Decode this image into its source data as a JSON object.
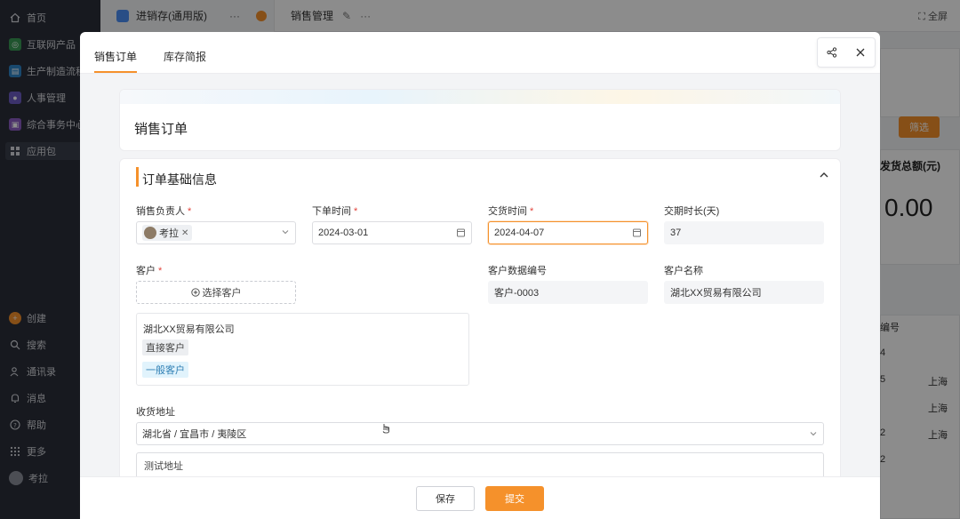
{
  "sidebar": {
    "items": [
      {
        "label": "首页",
        "icon": "home-icon"
      },
      {
        "label": "互联网产品",
        "icon": "app-icon"
      },
      {
        "label": "生产制造流程",
        "icon": "app-icon"
      },
      {
        "label": "人事管理",
        "icon": "app-icon"
      },
      {
        "label": "综合事务中心",
        "icon": "app-icon"
      },
      {
        "label": "应用包",
        "icon": "grid-icon"
      }
    ],
    "bottom_items": [
      {
        "label": "创建",
        "icon": "plus-icon"
      },
      {
        "label": "搜索",
        "icon": "search-icon"
      },
      {
        "label": "通讯录",
        "icon": "contacts-icon"
      },
      {
        "label": "消息",
        "icon": "bell-icon"
      },
      {
        "label": "帮助",
        "icon": "help-icon"
      },
      {
        "label": "更多",
        "icon": "more-grid-icon"
      },
      {
        "label": "考拉",
        "icon": "avatar"
      }
    ]
  },
  "topbar": {
    "app_name": "进销存(通用版)",
    "page_title": "销售管理",
    "fullscreen": "全屏"
  },
  "background": {
    "filter_button": "筛选",
    "stat_label": "发货总额(元)",
    "stat_value": "0.00",
    "table_header": "编号",
    "table_cells": [
      "4",
      "5",
      "上海",
      "上海",
      "2",
      "上海",
      "2"
    ]
  },
  "modal": {
    "tabs": [
      {
        "label": "销售订单",
        "active": true
      },
      {
        "label": "库存简报",
        "active": false
      }
    ],
    "title": "销售订单",
    "section_title": "订单基础信息",
    "fields": {
      "salesperson": {
        "label": "销售负责人",
        "required": true,
        "value": "考拉"
      },
      "order_date": {
        "label": "下单时间",
        "required": true,
        "value": "2024-03-01"
      },
      "delivery_date": {
        "label": "交货时间",
        "required": true,
        "value": "2024-04-07"
      },
      "delivery_period": {
        "label": "交期时长(天)",
        "value": "37"
      },
      "customer": {
        "label": "客户",
        "required": true,
        "select_label": "选择客户"
      },
      "customer_code": {
        "label": "客户数据编号",
        "value": "客户-0003"
      },
      "customer_name": {
        "label": "客户名称",
        "value": "湖北XX贸易有限公司"
      },
      "shipping_address": {
        "label": "收货地址",
        "value": "湖北省 / 宜昌市 / 夷陵区",
        "detail": "测试地址"
      }
    },
    "customer_card": {
      "name": "湖北XX贸易有限公司",
      "tags": [
        "直接客户",
        "一般客户"
      ]
    },
    "footer": {
      "save": "保存",
      "submit": "提交"
    }
  },
  "colors": {
    "accent": "#f5912b",
    "sidebar_bg": "#2b2f3a",
    "required": "#e2433b"
  }
}
